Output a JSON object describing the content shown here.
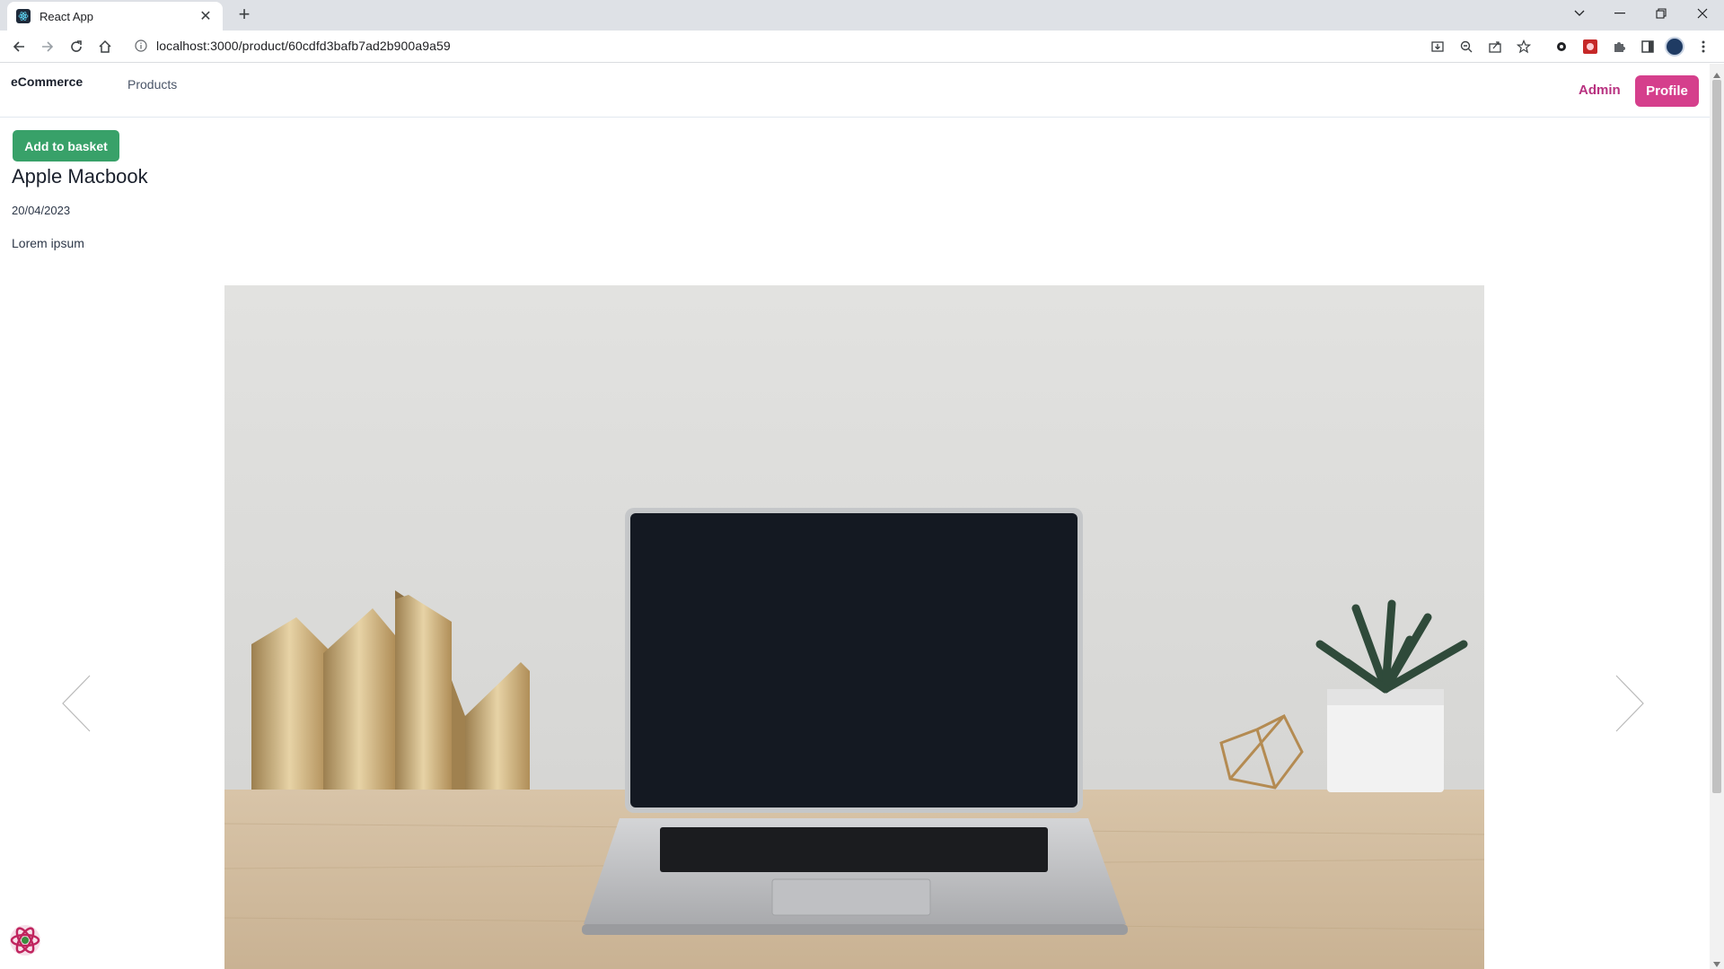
{
  "browser": {
    "tab_title": "React App",
    "url": "localhost:3000/product/60cdfd3bafb7ad2b900a9a59",
    "icons": [
      "react-favicon",
      "close-icon",
      "plus-icon",
      "chevron-down-icon",
      "minimize-icon",
      "restore-icon",
      "close-window-icon",
      "back-icon",
      "forward-icon",
      "reload-icon",
      "home-icon",
      "info-icon",
      "install-icon",
      "zoom-icon",
      "share-icon",
      "star-icon",
      "extension-icons",
      "puzzle-icon",
      "sidebar-icon",
      "avatar",
      "kebab-menu-icon"
    ]
  },
  "navbar": {
    "brand": "eCommerce",
    "products": "Products",
    "admin": "Admin",
    "profile": "Profile"
  },
  "product": {
    "add_to_basket": "Add to basket",
    "title": "Apple Macbook",
    "date": "20/04/2023",
    "description": "Lorem ipsum"
  },
  "carousel": {
    "prev_icon": "chevron-left-icon",
    "next_icon": "chevron-right-icon"
  },
  "colors": {
    "add_to_basket": "#38a169",
    "profile": "#d53f8c",
    "admin": "#b83280"
  }
}
